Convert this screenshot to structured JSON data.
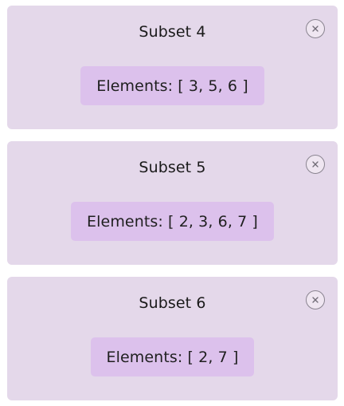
{
  "subsets": [
    {
      "title": "Subset 4",
      "elements_text": "Elements: [ 3, 5, 6 ]",
      "close_label": "×"
    },
    {
      "title": "Subset 5",
      "elements_text": "Elements: [ 2, 3, 6, 7 ]",
      "close_label": "×"
    },
    {
      "title": "Subset 6",
      "elements_text": "Elements: [ 2, 7 ]",
      "close_label": "×"
    }
  ],
  "colors": {
    "card_background": "#e4d8ea",
    "chip_background": "#dcc1ec",
    "close_border": "#8a8490"
  },
  "icons": {
    "close": "close-icon"
  }
}
